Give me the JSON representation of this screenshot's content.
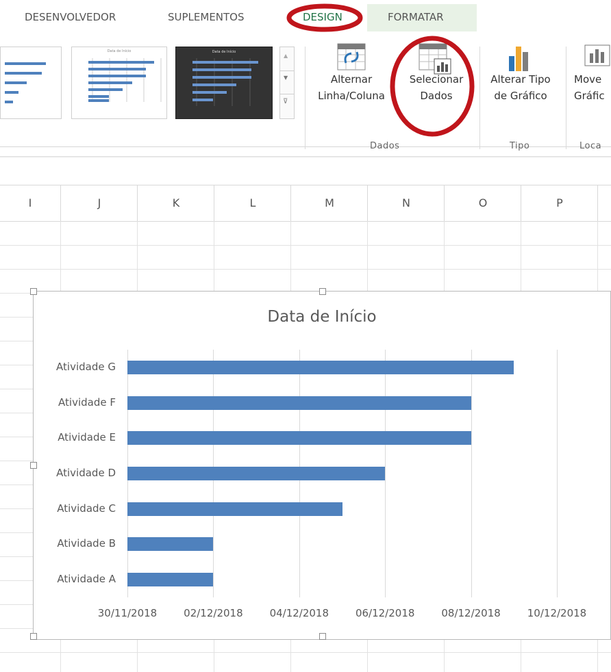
{
  "ribbon": {
    "tabs": [
      "DESENVOLVEDOR",
      "SUPLEMENTOS",
      "DESIGN",
      "FORMATAR"
    ],
    "gallery_thumb_titles": [
      "Data de Início",
      "Data de Início"
    ],
    "buttons": {
      "alternar": {
        "line1": "Alternar",
        "line2": "Linha/Coluna"
      },
      "selecionar": {
        "line1": "Selecionar",
        "line2": "Dados"
      },
      "alterar": {
        "line1": "Alterar Tipo",
        "line2": "de Gráfico"
      },
      "mover": {
        "line1": "Move",
        "line2": "Gráfic"
      }
    },
    "groups": {
      "dados": "Dados",
      "tipo": "Tipo",
      "local": "Loca"
    }
  },
  "sheet": {
    "columns": [
      "I",
      "J",
      "K",
      "L",
      "M",
      "N",
      "O",
      "P"
    ]
  },
  "colors": {
    "bar": "#4f81bd",
    "annotation": "#c0151b",
    "formatar_tab_bg": "#e8f2e6"
  },
  "chart_data": {
    "type": "bar",
    "orientation": "horizontal",
    "title": "Data de Início",
    "categories": [
      "Atividade G",
      "Atividade F",
      "Atividade E",
      "Atividade D",
      "Atividade C",
      "Atividade B",
      "Atividade A"
    ],
    "values": [
      "09/12/2018",
      "08/12/2018",
      "08/12/2018",
      "06/12/2018",
      "05/12/2018",
      "02/12/2018",
      "02/12/2018"
    ],
    "x_ticks": [
      "30/11/2018",
      "02/12/2018",
      "04/12/2018",
      "06/12/2018",
      "08/12/2018",
      "10/12/2018"
    ],
    "xlim": [
      "30/11/2018",
      "10/12/2018"
    ],
    "grid": true,
    "legend": "none"
  }
}
